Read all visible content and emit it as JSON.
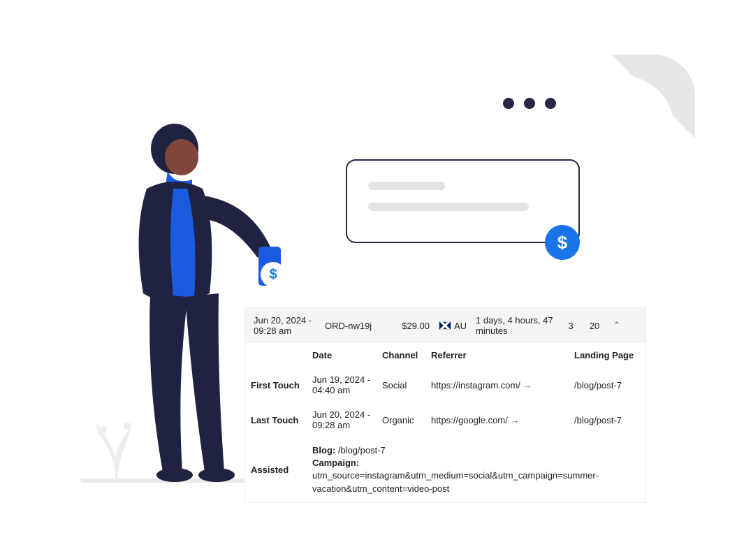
{
  "browser": {
    "dots": 3,
    "dollar_symbol_card": "$",
    "dollar_symbol_phone": "$"
  },
  "order": {
    "date": "Jun 20, 2024 - 09:28 am",
    "id": "ORD-nw19j",
    "amount": "$29.00",
    "country_code": "AU",
    "duration": "1 days, 4 hours, 47 minutes",
    "stat1": "3",
    "stat2": "20",
    "caret": "⌃"
  },
  "touch": {
    "headers": {
      "date": "Date",
      "channel": "Channel",
      "referrer": "Referrer",
      "landing": "Landing Page"
    },
    "first": {
      "label": "First Touch",
      "date": "Jun 19, 2024 - 04:40 am",
      "channel": "Social",
      "referrer": "https://instagram.com/",
      "arrow": "→",
      "landing": "/blog/post-7"
    },
    "last": {
      "label": "Last Touch",
      "date": "Jun 20, 2024 - 09:28 am",
      "channel": "Organic",
      "referrer": "https://google.com/",
      "arrow": "→",
      "landing": "/blog/post-7"
    },
    "assisted": {
      "label": "Assisted",
      "blog_label": "Blog:",
      "blog_value": "/blog/post-7",
      "campaign_label": "Campaign:",
      "campaign_value": "utm_source=instagram&utm_medium=social&utm_campaign=summer-vacation&utm_content=video-post"
    }
  }
}
